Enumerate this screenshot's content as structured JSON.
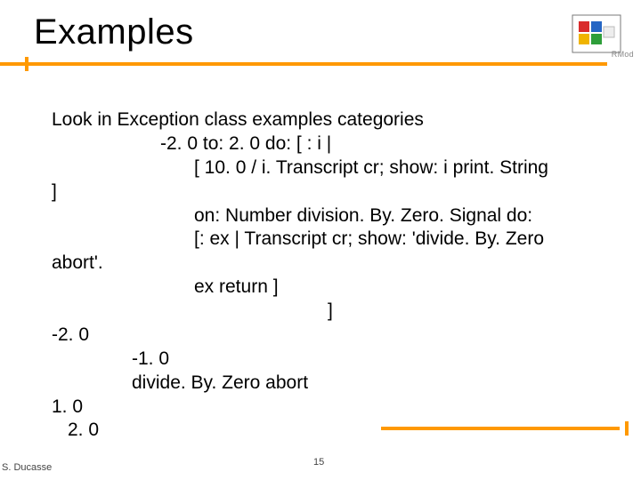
{
  "title": "Examples",
  "logo_label": "RMod",
  "lines": {
    "l1": "Look in Exception class examples categories",
    "l2": "-2. 0 to: 2. 0 do: [ : i |",
    "l3": "[ 10. 0 / i. Transcript cr; show: i print. String",
    "l4": "]",
    "l5": "on: Number division. By. Zero. Signal do:",
    "l6": "[: ex | Transcript cr; show: 'divide. By. Zero",
    "l7": "abort'.",
    "l8": "ex return ]",
    "l9": "]",
    "l10": "-2. 0",
    "l11": "-1. 0",
    "l12": "divide. By. Zero abort",
    "l13": "1. 0",
    "l14": "2. 0"
  },
  "footer": {
    "author": "S. Ducasse",
    "page": "15"
  }
}
